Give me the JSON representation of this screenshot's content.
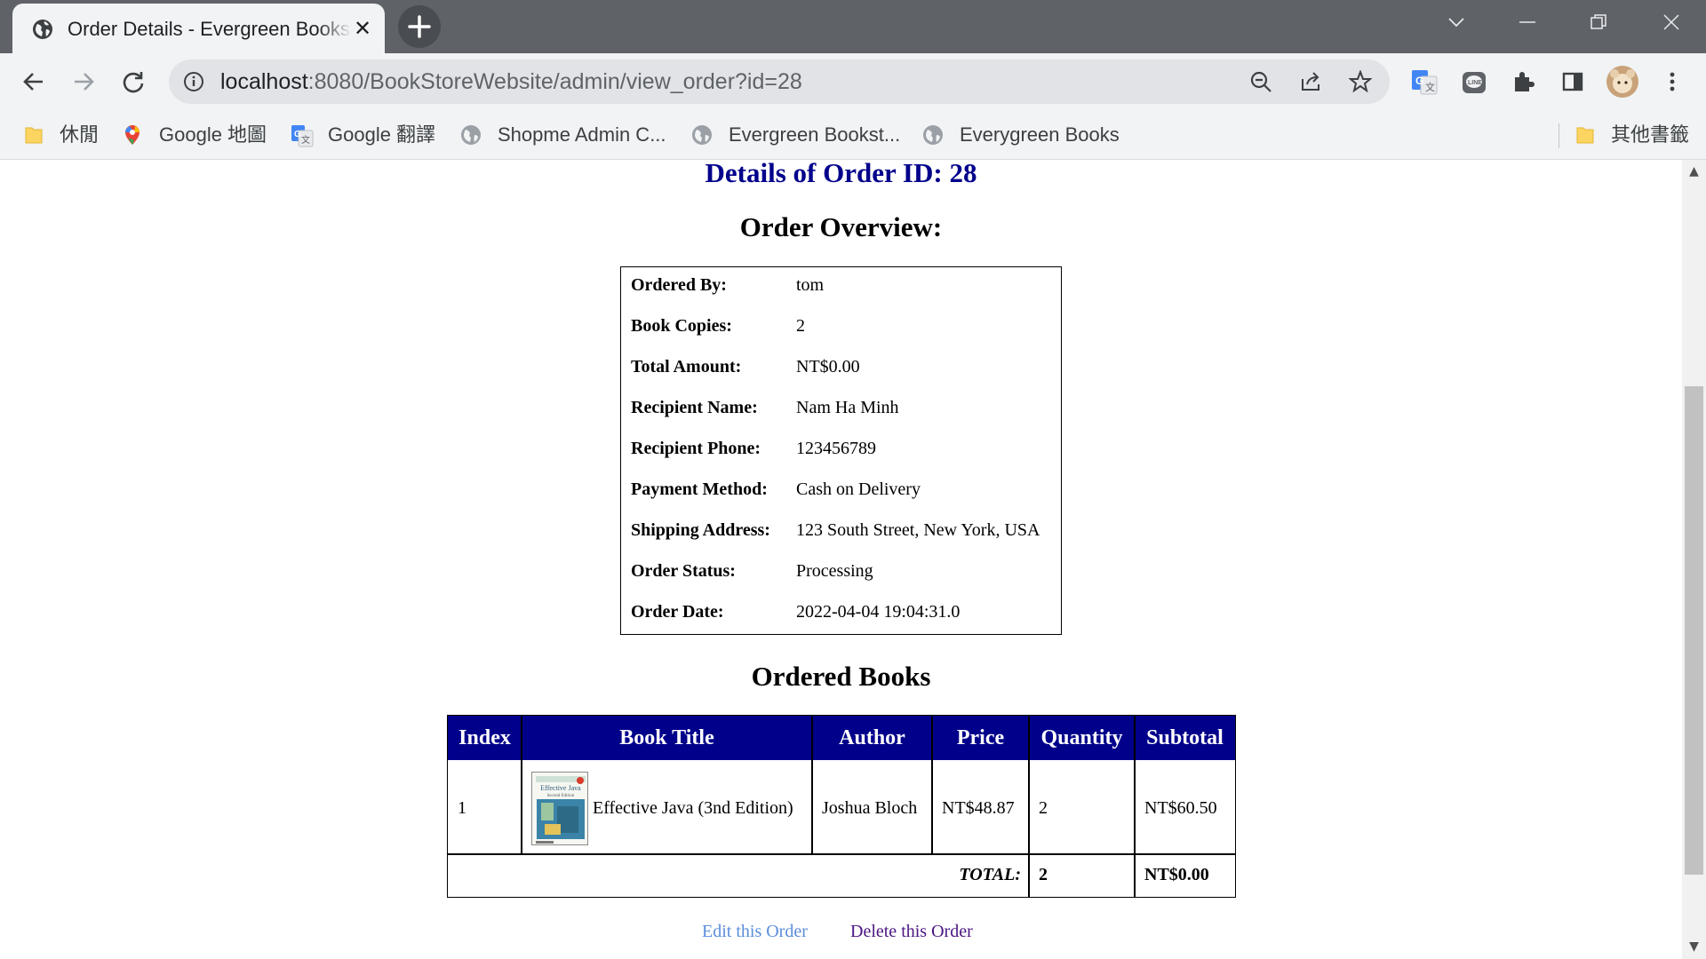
{
  "browser": {
    "tab_title": "Order Details - Evergreen Bookstore",
    "url_host": "localhost",
    "url_rest": ":8080/BookStoreWebsite/admin/view_order?id=28",
    "bookmarks": [
      "休閒",
      "Google 地圖",
      "Google 翻譯",
      "Shopme Admin C...",
      "Evergreen Bookst...",
      "Everygreen Books"
    ],
    "other_bookmarks": "其他書籤"
  },
  "page": {
    "title": "Details of Order ID: 28",
    "overview_heading": "Order Overview:",
    "books_heading": "Ordered Books"
  },
  "overview": [
    {
      "label": "Ordered By:",
      "value": "tom"
    },
    {
      "label": "Book Copies:",
      "value": "2"
    },
    {
      "label": "Total Amount:",
      "value": "NT$0.00"
    },
    {
      "label": "Recipient Name:",
      "value": "Nam Ha Minh"
    },
    {
      "label": "Recipient Phone:",
      "value": "123456789"
    },
    {
      "label": "Payment Method:",
      "value": "Cash on Delivery"
    },
    {
      "label": "Shipping Address:",
      "value": "123 South Street, New York, USA"
    },
    {
      "label": "Order Status:",
      "value": "Processing"
    },
    {
      "label": "Order Date:",
      "value": "2022-04-04 19:04:31.0"
    }
  ],
  "books_table": {
    "headers": [
      "Index",
      "Book Title",
      "Author",
      "Price",
      "Quantity",
      "Subtotal"
    ],
    "rows": [
      {
        "index": "1",
        "cover_title": "Effective Java",
        "cover_subtitle": "Second Edition",
        "title": "Effective Java (3nd Edition)",
        "author": "Joshua Bloch",
        "price": "NT$48.87",
        "quantity": "2",
        "subtotal": "NT$60.50"
      }
    ],
    "total_label": "TOTAL:",
    "total_quantity": "2",
    "total_amount": "NT$0.00"
  },
  "actions": {
    "edit": "Edit this Order",
    "delete": "Delete this Order"
  },
  "colors": {
    "heading_blue": "#00008b",
    "link_unvisited": "#5b8ddb",
    "link_visited": "#4b1583"
  }
}
